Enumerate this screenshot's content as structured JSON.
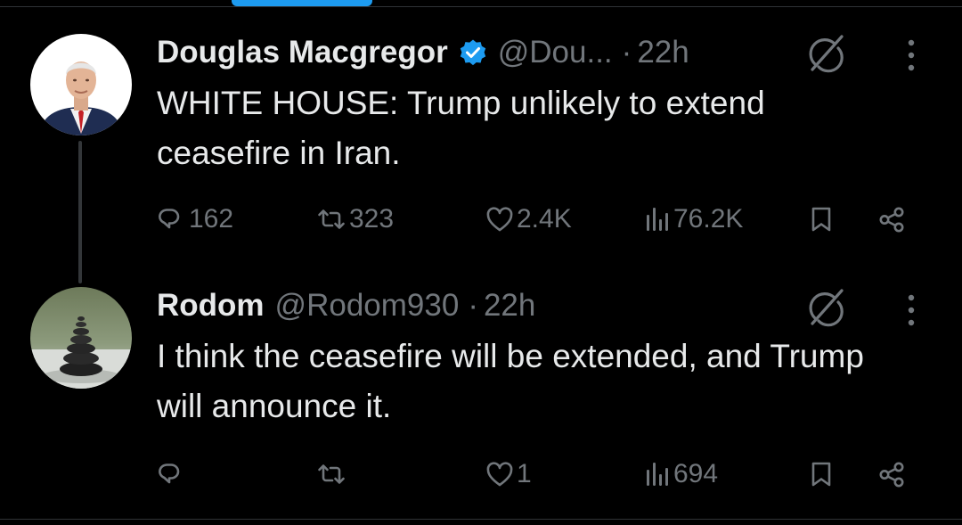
{
  "colors": {
    "background": "#000000",
    "primary_text": "#e7e9ea",
    "secondary_text": "#71767b",
    "accent": "#1d9bf0",
    "divider": "#2f3336"
  },
  "tweets": [
    {
      "author": {
        "name": "Douglas Macgregor",
        "handle": "@Dou...",
        "verified": true,
        "avatar": "man-in-suit-portrait"
      },
      "separator": "·",
      "time": "22h",
      "text": "WHITE HOUSE: Trump unlikely to extend ceasefire in Iran.",
      "stats": {
        "replies": "162",
        "reposts": "323",
        "likes": "2.4K",
        "views": "76.2K"
      }
    },
    {
      "author": {
        "name": "Rodom",
        "handle": "@Rodom930",
        "verified": false,
        "avatar": "stacked-stones-photo"
      },
      "separator": "·",
      "time": "22h",
      "text": "I think the ceasefire will be extended, and Trump will announce it.",
      "stats": {
        "replies": "",
        "reposts": "",
        "likes": "1",
        "views": "694"
      }
    }
  ],
  "icons": {
    "reply": "reply-icon",
    "repost": "repost-icon",
    "like": "heart-icon",
    "views": "views-chart-icon",
    "bookmark": "bookmark-icon",
    "share": "share-icon",
    "grok": "grok-icon",
    "more": "more-options-icon",
    "verified": "verified-badge-icon"
  }
}
